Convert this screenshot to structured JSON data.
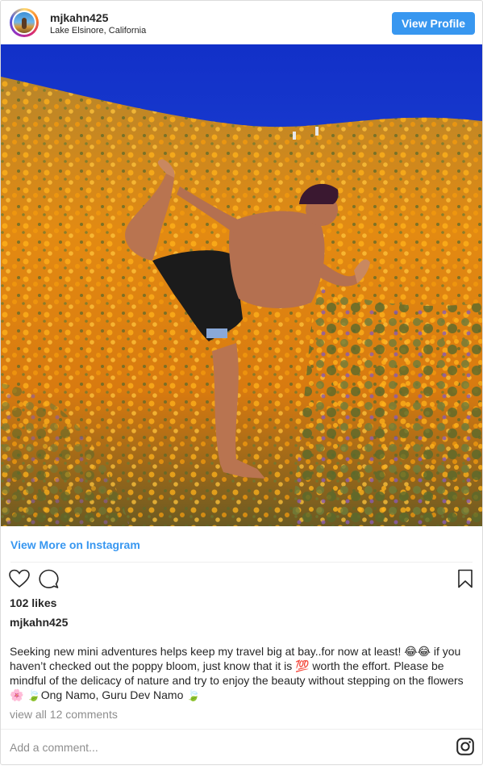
{
  "header": {
    "username": "mjkahn425",
    "location": "Lake Elsinore, California",
    "view_profile_label": "View Profile"
  },
  "post": {
    "image_alt": "Man doing dancer yoga pose in poppy field",
    "view_more_label": "View More on Instagram",
    "likes": "102 likes",
    "caption_username": "mjkahn425",
    "caption_text": "Seeking new mini adventures helps keep my travel big at bay..for now at least! 😂😂 if you haven’t checked out the poppy bloom, just know that it is 💯 worth the effort. Please be mindful of the delicacy of nature and try to enjoy the beauty without stepping on the flowers 🌸 🍃Ong Namo, Guru Dev Namo 🍃",
    "view_comments_label": "view all 12 comments"
  },
  "comment_box": {
    "placeholder": "Add a comment..."
  },
  "icons": {
    "like": "heart-icon",
    "comment": "comment-bubble-icon",
    "save": "bookmark-icon",
    "brand": "instagram-logo-icon"
  },
  "colors": {
    "accent": "#3897f0",
    "border": "#dbdbdb",
    "muted_text": "#8e8e8e"
  }
}
